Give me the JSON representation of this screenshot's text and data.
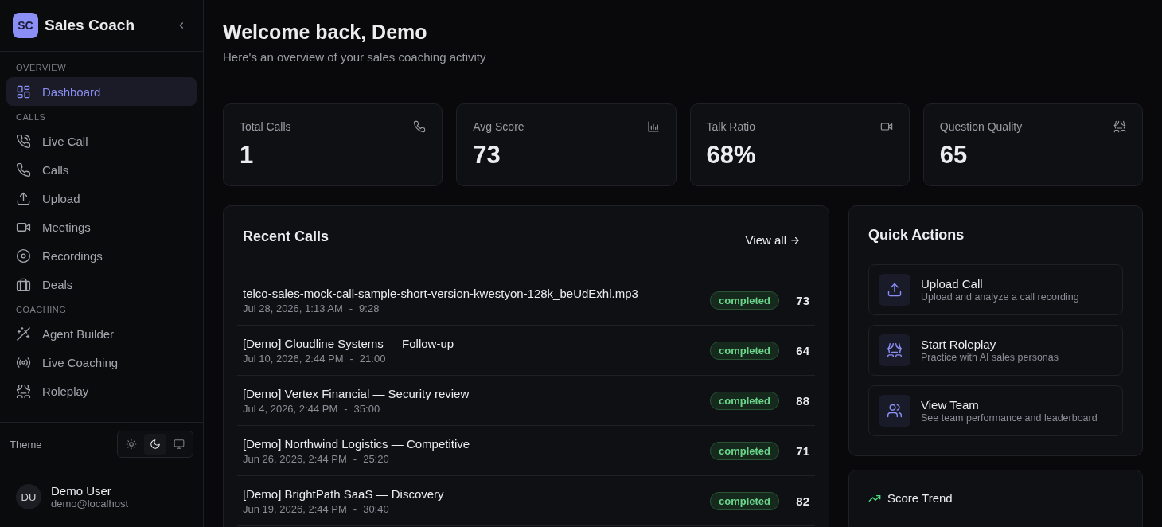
{
  "sidebar": {
    "logo": "SC",
    "app_name": "Sales Coach",
    "sections": [
      {
        "label": "OVERVIEW",
        "items": [
          {
            "label": "Dashboard",
            "kind": "grid",
            "selected": true
          }
        ]
      },
      {
        "label": "CALLS",
        "items": [
          {
            "label": "Live Call",
            "kind": "phone-wave",
            "selected": false
          },
          {
            "label": "Calls",
            "kind": "phone",
            "selected": false
          },
          {
            "label": "Upload",
            "kind": "upload",
            "selected": false
          },
          {
            "label": "Meetings",
            "kind": "video",
            "selected": false
          },
          {
            "label": "Recordings",
            "kind": "disc",
            "selected": false
          },
          {
            "label": "Deals",
            "kind": "briefcase",
            "selected": false
          }
        ]
      },
      {
        "label": "COACHING",
        "items": [
          {
            "label": "Agent Builder",
            "kind": "wand",
            "selected": false
          },
          {
            "label": "Live Coaching",
            "kind": "radio",
            "selected": false
          },
          {
            "label": "Roleplay",
            "kind": "theater",
            "selected": false
          }
        ]
      }
    ],
    "theme": {
      "label": "Theme",
      "options": [
        {
          "kind": "sun",
          "selected": false
        },
        {
          "kind": "moon",
          "selected": true
        },
        {
          "kind": "monitor",
          "selected": false
        }
      ]
    },
    "user": {
      "initials": "DU",
      "name": "Demo User",
      "email": "demo@localhost"
    }
  },
  "header": {
    "title": "Welcome back, Demo",
    "subtitle": "Here's an overview of your sales coaching activity"
  },
  "stats": [
    {
      "label": "Total Calls",
      "value": "1",
      "kind": "phone"
    },
    {
      "label": "Avg Score",
      "value": "73",
      "kind": "chart"
    },
    {
      "label": "Talk Ratio",
      "value": "68%",
      "kind": "video"
    },
    {
      "label": "Question Quality",
      "value": "65",
      "kind": "theater"
    }
  ],
  "recent_calls": {
    "title": "Recent Calls",
    "link": "View all",
    "rows": [
      {
        "name": "telco-sales-mock-call-sample-short-version-kwestyon-128k_beUdExhl.mp3",
        "date": "Jul 28, 2026, 1:13 AM",
        "separator": "-",
        "duration": "9:28",
        "status": "completed",
        "score": "73"
      },
      {
        "name": "[Demo] Cloudline Systems — Follow-up",
        "date": "Jul 10, 2026, 2:44 PM",
        "separator": "-",
        "duration": "21:00",
        "status": "completed",
        "score": "64"
      },
      {
        "name": "[Demo] Vertex Financial — Security review",
        "date": "Jul 4, 2026, 2:44 PM",
        "separator": "-",
        "duration": "35:00",
        "status": "completed",
        "score": "88"
      },
      {
        "name": "[Demo] Northwind Logistics — Competitive",
        "date": "Jun 26, 2026, 2:44 PM",
        "separator": "-",
        "duration": "25:20",
        "status": "completed",
        "score": "71"
      },
      {
        "name": "[Demo] BrightPath SaaS — Discovery",
        "date": "Jun 19, 2026, 2:44 PM",
        "separator": "-",
        "duration": "30:40",
        "status": "completed",
        "score": "82"
      }
    ]
  },
  "quick_actions": {
    "title": "Quick Actions",
    "items": [
      {
        "title": "Upload Call",
        "description": "Upload and analyze a call recording",
        "kind": "upload"
      },
      {
        "title": "Start Roleplay",
        "description": "Practice with AI sales personas",
        "kind": "theater"
      },
      {
        "title": "View Team",
        "description": "See team performance and leaderboard",
        "kind": "users"
      }
    ]
  },
  "score_trend": {
    "title": "Score Trend"
  }
}
